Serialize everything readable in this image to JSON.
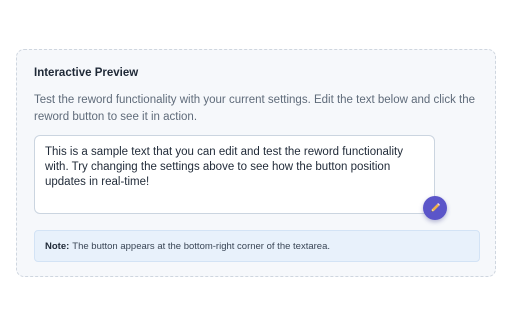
{
  "preview": {
    "title": "Interactive Preview",
    "description": "Test the reword functionality with your current settings. Edit the text below and click the reword button to see it in action.",
    "textarea_value": "This is a sample text that you can edit and test the reword functionality with. Try changing the settings above to see how the button position updates in real-time!",
    "reword_button_icon": "pencil-icon",
    "note": {
      "label": "Note:",
      "text": "The button appears at the bottom-right corner of the textarea."
    }
  },
  "colors": {
    "accent": "#5b55c9",
    "pencil": "#f0b24b",
    "note_background": "#e8f1fb",
    "card_background": "#f6f8fb"
  }
}
